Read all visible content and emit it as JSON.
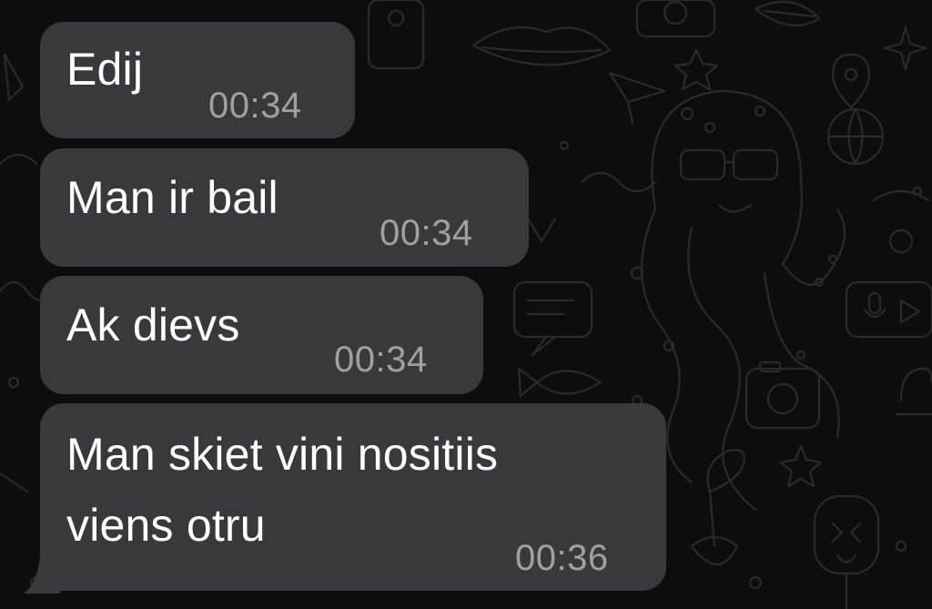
{
  "colors": {
    "background": "#0d0d0e",
    "bubble": "#39393b",
    "message_text": "#ffffff",
    "timestamp_text": "#a0a0a3",
    "wallpaper_doodle": "#2a2a2c"
  },
  "messages": [
    {
      "text": "Edij",
      "time": "00:34"
    },
    {
      "text": "Man ir bail",
      "time": "00:34"
    },
    {
      "text": "Ak dievs",
      "time": "00:34"
    },
    {
      "lines": [
        "Man skiet vini nositiis",
        "viens otru"
      ],
      "time": "00:36"
    }
  ]
}
